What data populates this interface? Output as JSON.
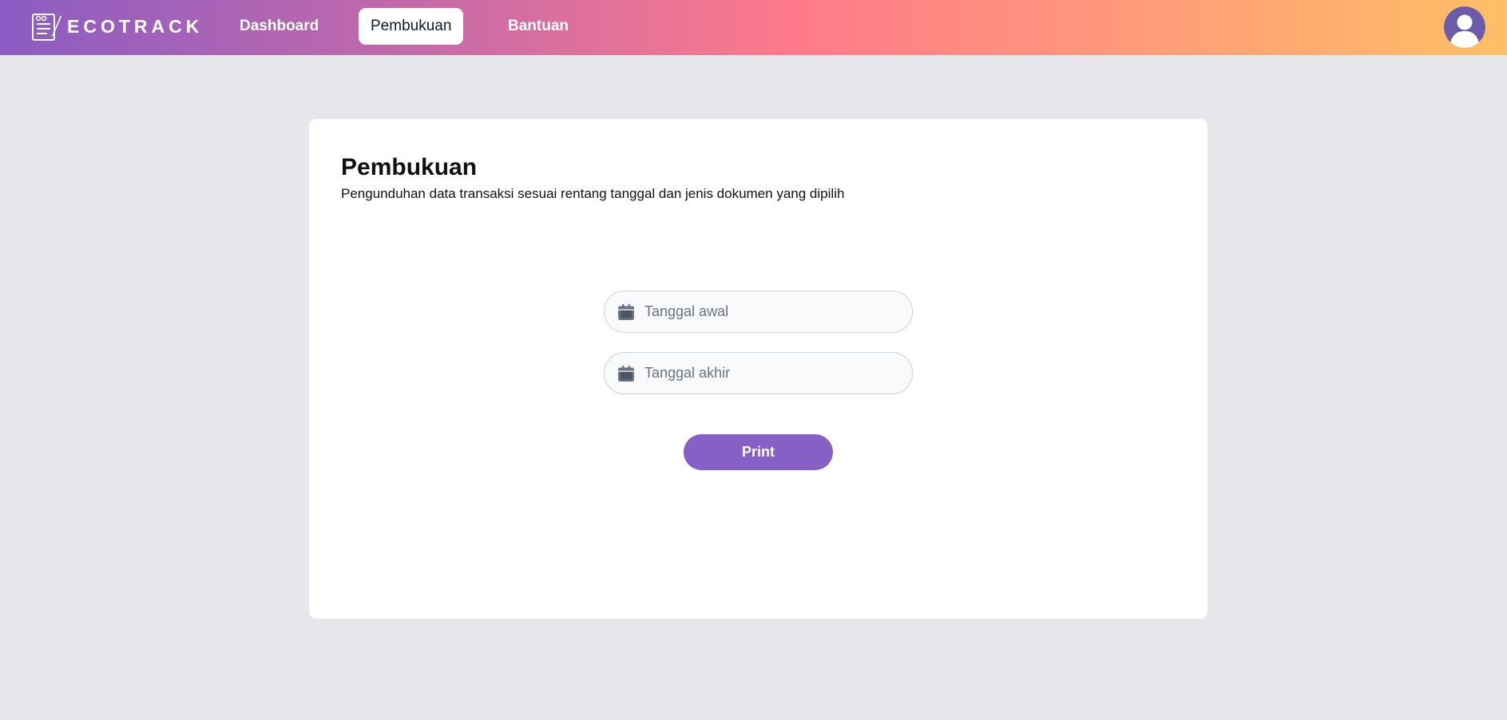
{
  "nav": {
    "brand": "ECOTRACK",
    "items": [
      {
        "label": "Dashboard",
        "active": false
      },
      {
        "label": "Pembukuan",
        "active": true
      },
      {
        "label": "Bantuan",
        "active": false
      }
    ]
  },
  "page": {
    "title": "Pembukuan",
    "subtitle": "Pengunduhan data transaksi sesuai rentang tanggal dan jenis dokumen yang dipilih"
  },
  "form": {
    "start_date": {
      "placeholder": "Tanggal awal",
      "value": "",
      "icon": "calendar-icon"
    },
    "end_date": {
      "placeholder": "Tanggal akhir",
      "value": "",
      "icon": "calendar-icon"
    },
    "print_label": "Print"
  },
  "colors": {
    "accent": "#8660c5",
    "background": "#e5e7eb",
    "gradient": [
      "#8b5cc4",
      "#ff7a8a",
      "#ffbf66"
    ]
  },
  "icons": {
    "brand": "ledger-pencil-icon",
    "avatar": "user-avatar-icon"
  }
}
